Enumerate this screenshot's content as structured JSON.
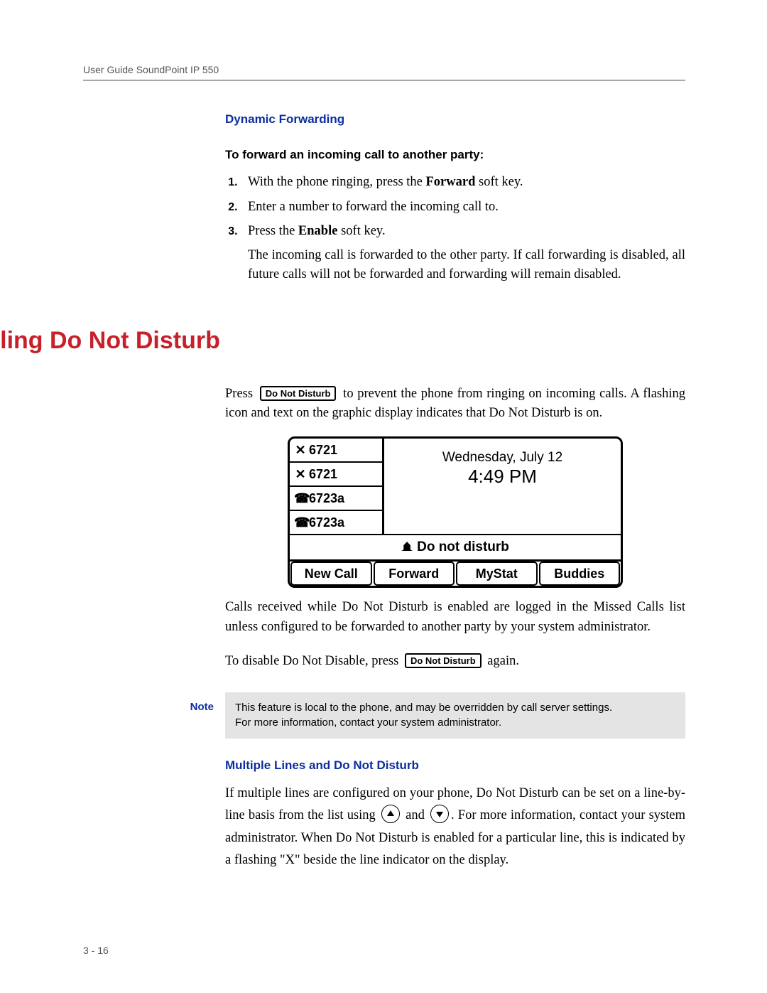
{
  "header": "User Guide SoundPoint IP 550",
  "page_number": "3 - 16",
  "sec1": {
    "title": "Dynamic Forwarding",
    "procedure_title": "To forward an incoming call to another party:",
    "step1_pre": "With the phone ringing, press the ",
    "step1_bold": "Forward",
    "step1_post": " soft key.",
    "step2": "Enter a number to forward the incoming call to.",
    "step3_pre": "Press the ",
    "step3_bold": "Enable",
    "step3_post": " soft key.",
    "tail": "The incoming call is forwarded to the other party. If call forwarding is disabled, all future calls will not be forwarded and forwarding will remain disabled."
  },
  "heading": "Enabling Do Not Disturb",
  "dnd": {
    "p1_pre": "Press ",
    "key_label": "Do Not Disturb",
    "p1_post": " to prevent the phone from ringing on incoming calls. A flashing icon and text on the graphic display indicates that Do Not Disturb is on.",
    "p2": "Calls received while Do Not Disturb is enabled are logged in the Missed Calls list unless configured to be forwarded to another party by your system administrator.",
    "p3_pre": "To disable Do Not Disable, press ",
    "p3_post": " again."
  },
  "lcd": {
    "lines": [
      "6721",
      "6721",
      "6723a",
      "6723a"
    ],
    "line_icons": [
      "✕",
      "✕",
      "☎",
      "☎"
    ],
    "date": "Wednesday, July 12",
    "time": "4:49 PM",
    "dnd_text": "Do not disturb",
    "softkeys": [
      "New Call",
      "Forward",
      "MyStat",
      "Buddies"
    ]
  },
  "note": {
    "label": "Note",
    "line1": "This feature is local to the phone, and may be overridden by call server settings.",
    "line2": "For more information, contact your system administrator."
  },
  "sec3": {
    "title": "Multiple Lines and Do Not Disturb",
    "p_pre": "If multiple lines are configured on your phone, Do Not Disturb can be set on a line-by-line basis from the list using ",
    "p_and": " and ",
    "p_post": ". For more information, contact your system administrator. When Do Not Disturb is enabled for a particular line, this is indicated by a flashing \"X\" beside the line indicator on the display."
  }
}
